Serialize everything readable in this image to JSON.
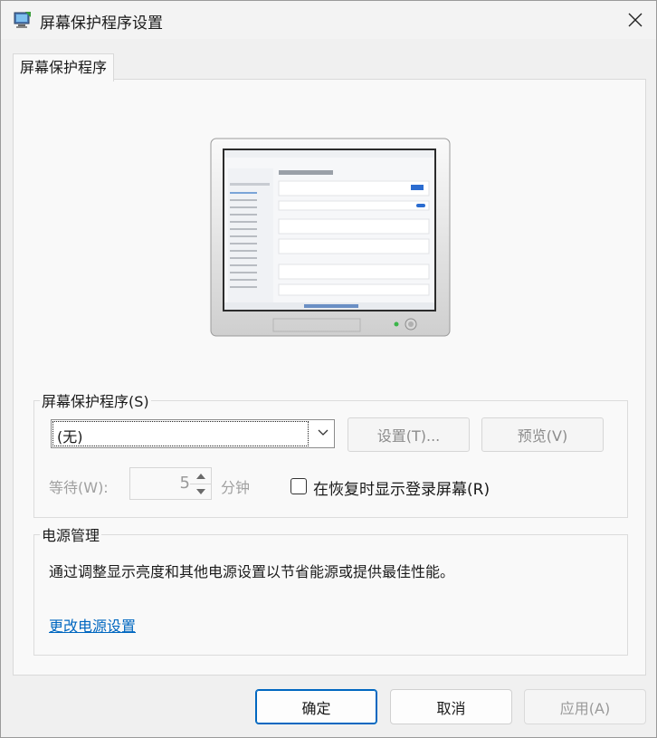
{
  "window": {
    "title": "屏幕保护程序设置",
    "app_icon": "monitor-settings-icon",
    "close_icon": "close-icon"
  },
  "tabs": [
    {
      "label": "屏幕保护程序",
      "active": true
    }
  ],
  "screensaver": {
    "group_label": "屏幕保护程序(S)",
    "selected": "(无)",
    "settings_button": "设置(T)...",
    "preview_button": "预览(V)",
    "wait_label": "等待(W):",
    "wait_value": "5",
    "minutes_label": "分钟",
    "resume_checkbox_label": "在恢复时显示登录屏幕(R)",
    "resume_checked": false
  },
  "power": {
    "group_label": "电源管理",
    "description": "通过调整显示亮度和其他电源设置以节省能源或提供最佳性能。",
    "link": "更改电源设置"
  },
  "footer": {
    "ok": "确定",
    "cancel": "取消",
    "apply": "应用(A)"
  },
  "colors": {
    "accent": "#0067c0",
    "disabled_text": "#9a9a9a",
    "background": "#f0f0f0"
  }
}
